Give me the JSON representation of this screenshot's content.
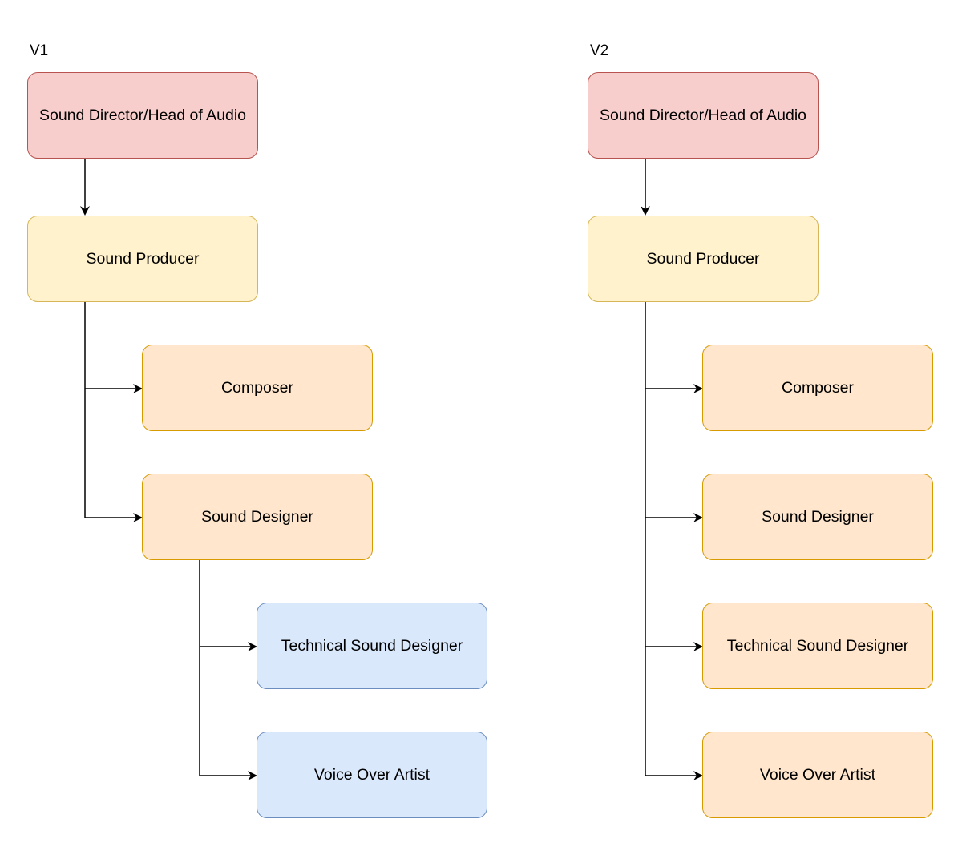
{
  "diagrams": [
    {
      "label": "V1",
      "nodes": [
        {
          "id": "director",
          "text": "Sound Director/Head of Audio",
          "style": "red"
        },
        {
          "id": "producer",
          "text": "Sound Producer",
          "style": "yellow"
        },
        {
          "id": "composer",
          "text": "Composer",
          "style": "orange"
        },
        {
          "id": "designer",
          "text": "Sound Designer",
          "style": "orange"
        },
        {
          "id": "tech",
          "text": "Technical Sound Designer",
          "style": "blue"
        },
        {
          "id": "vo",
          "text": "Voice Over Artist",
          "style": "blue"
        }
      ],
      "edges": [
        [
          "director",
          "producer"
        ],
        [
          "producer",
          "composer"
        ],
        [
          "producer",
          "designer"
        ],
        [
          "designer",
          "tech"
        ],
        [
          "designer",
          "vo"
        ]
      ]
    },
    {
      "label": "V2",
      "nodes": [
        {
          "id": "director",
          "text": "Sound Director/Head of Audio",
          "style": "red"
        },
        {
          "id": "producer",
          "text": "Sound Producer",
          "style": "yellow"
        },
        {
          "id": "composer",
          "text": "Composer",
          "style": "orange"
        },
        {
          "id": "designer",
          "text": "Sound Designer",
          "style": "orange"
        },
        {
          "id": "tech",
          "text": "Technical Sound Designer",
          "style": "orange"
        },
        {
          "id": "vo",
          "text": "Voice Over Artist",
          "style": "orange"
        }
      ],
      "edges": [
        [
          "director",
          "producer"
        ],
        [
          "producer",
          "composer"
        ],
        [
          "producer",
          "designer"
        ],
        [
          "producer",
          "tech"
        ],
        [
          "producer",
          "vo"
        ]
      ]
    }
  ],
  "colors": {
    "red_fill": "#f8cecc",
    "red_stroke": "#b85450",
    "yellow_fill": "#fff2cc",
    "yellow_stroke": "#d6b656",
    "orange_fill": "#ffe6cc",
    "orange_stroke": "#d79b00",
    "blue_fill": "#dae8fc",
    "blue_stroke": "#6c8ebf"
  }
}
